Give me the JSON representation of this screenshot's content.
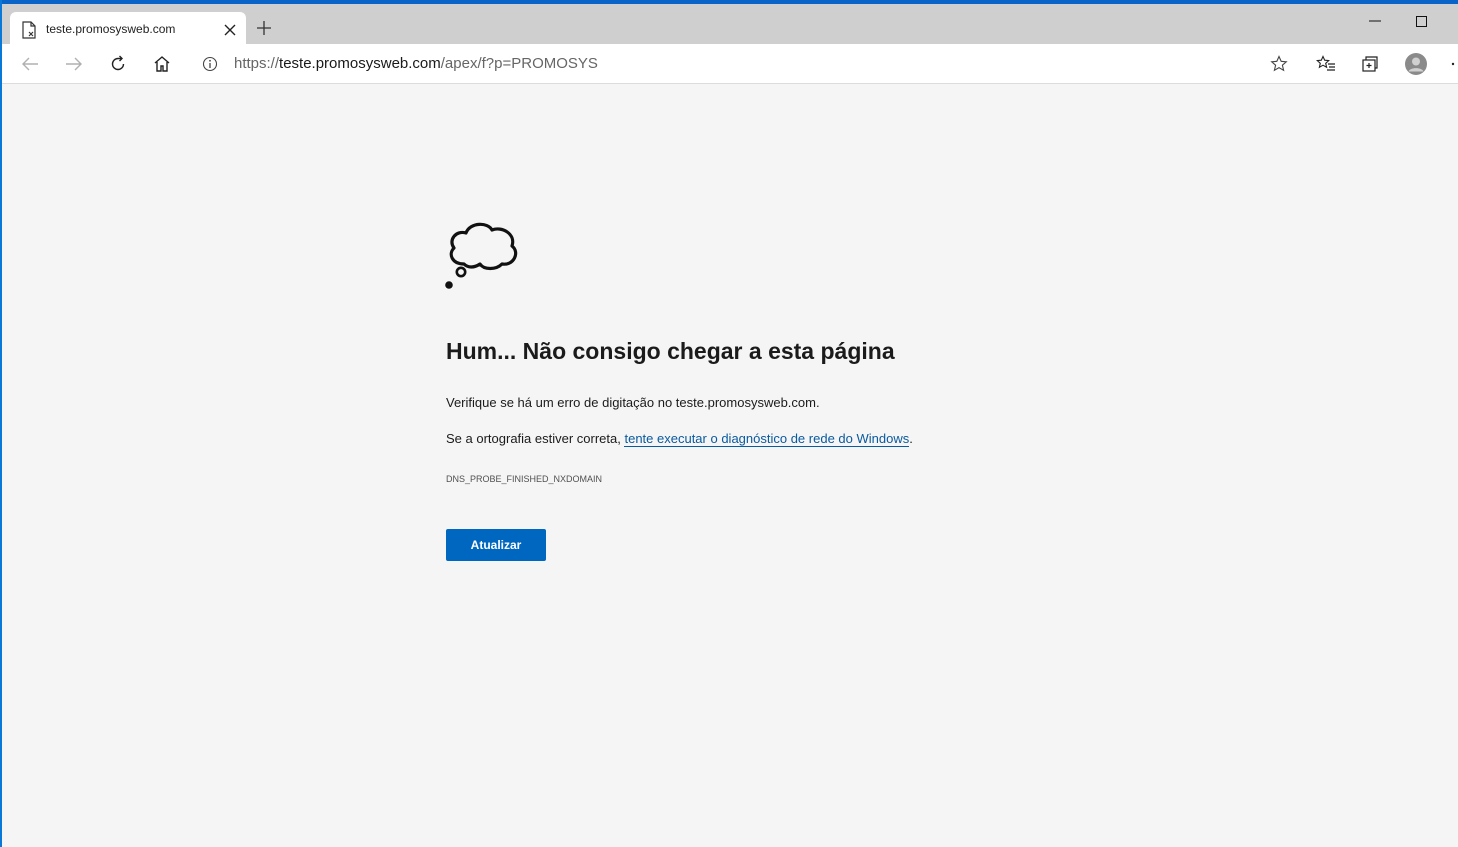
{
  "browser": {
    "tab": {
      "title": "teste.promosysweb.com",
      "favicon": "page-error-icon"
    },
    "toolbar": {
      "back_icon": "arrow-left-icon",
      "forward_icon": "arrow-right-icon",
      "refresh_icon": "refresh-icon",
      "home_icon": "home-icon"
    },
    "address": {
      "scheme": "https://",
      "host": "teste.promosysweb.com",
      "path": "/apex/f?p=PROMOSYS"
    }
  },
  "error_page": {
    "icon": "thought-cloud-icon",
    "title": "Hum... Não consigo chegar a esta página",
    "line1": "Verifique se há um erro de digitação no teste.promosysweb.com.",
    "line2_prefix": "Se a ortografia estiver correta, ",
    "line2_link": "tente executar o diagnóstico de rede do Windows",
    "line2_suffix": ".",
    "error_code": "DNS_PROBE_FINISHED_NXDOMAIN",
    "button_label": "Atualizar"
  },
  "colors": {
    "accent": "#0067c0",
    "link": "#0a5aa0",
    "background": "#f5f5f5"
  }
}
